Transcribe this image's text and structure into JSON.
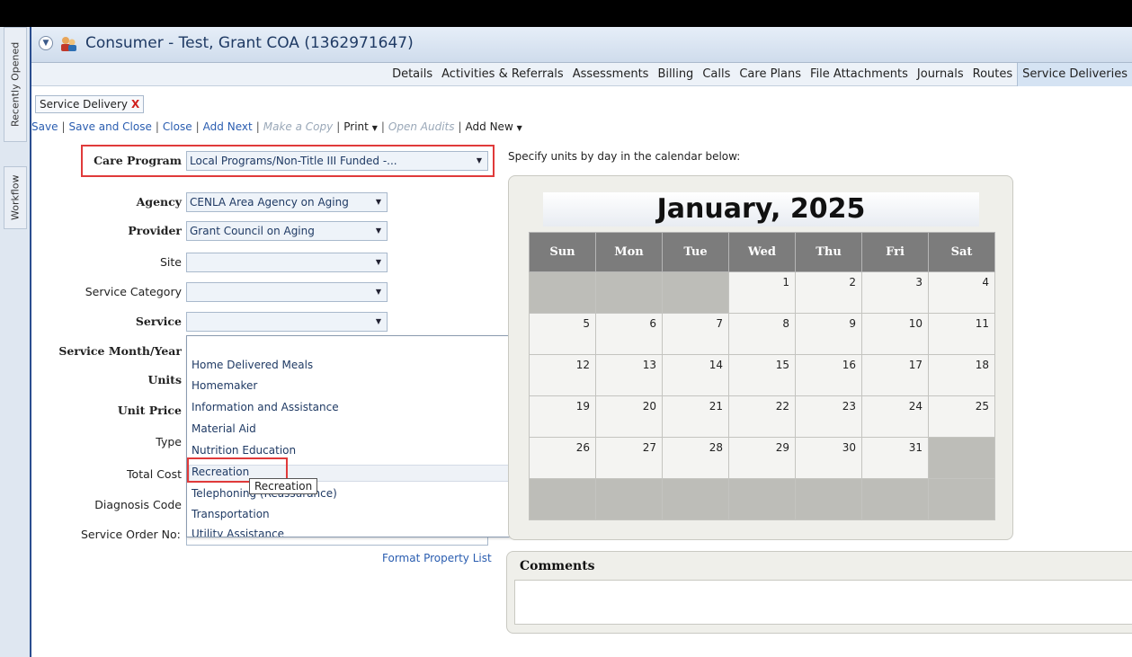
{
  "side_tabs": [
    "Recently Opened",
    "Workflow"
  ],
  "window": {
    "title": "Consumer - Test, Grant COA (1362971647)"
  },
  "tabs": [
    {
      "label": "Details"
    },
    {
      "label": "Activities & Referrals"
    },
    {
      "label": "Assessments"
    },
    {
      "label": "Billing"
    },
    {
      "label": "Calls"
    },
    {
      "label": "Care Plans"
    },
    {
      "label": "File Attachments"
    },
    {
      "label": "Journals"
    },
    {
      "label": "Routes"
    },
    {
      "label": "Service Deliveries",
      "active": true
    }
  ],
  "doc_tab": {
    "label": "Service Delivery",
    "close": "X"
  },
  "toolbar": {
    "save": "Save",
    "save_close": "Save and Close",
    "close": "Close",
    "add_next": "Add Next",
    "make_copy": "Make a Copy",
    "print": "Print",
    "open_audits": "Open Audits",
    "add_new": "Add New"
  },
  "form": {
    "care_program_label": "Care Program",
    "care_program_value": "Local Programs/Non-Title III Funded -...",
    "agency_label": "Agency",
    "agency_value": "CENLA Area Agency on Aging",
    "provider_label": "Provider",
    "provider_value": "Grant Council on Aging",
    "site_label": "Site",
    "service_category_label": "Service Category",
    "service_label": "Service",
    "service_month_year_label": "Service Month/Year",
    "units_label": "Units",
    "unit_price_label": "Unit Price",
    "type_label": "Type",
    "total_cost_label": "Total Cost",
    "diagnosis_code_label": "Diagnosis Code",
    "service_order_label": "Service Order No:",
    "format_property_list": "Format Property List"
  },
  "service_dropdown": {
    "items": [
      "Home Delivered Meals",
      "Homemaker",
      "Information and Assistance",
      "Material Aid",
      "Nutrition Education",
      "Recreation",
      "Telephoning (Reassurance)",
      "Transportation",
      "Utility Assistance"
    ],
    "hovered": "Recreation",
    "tooltip": "Recreation"
  },
  "calendar": {
    "instructions": "Specify units by day in the calendar below:",
    "title": "January, 2025",
    "days": [
      "Sun",
      "Mon",
      "Tue",
      "Wed",
      "Thu",
      "Fri",
      "Sat"
    ],
    "weeks": [
      [
        "",
        "",
        "",
        "1",
        "2",
        "3",
        "4"
      ],
      [
        "5",
        "6",
        "7",
        "8",
        "9",
        "10",
        "11"
      ],
      [
        "12",
        "13",
        "14",
        "15",
        "16",
        "17",
        "18"
      ],
      [
        "19",
        "20",
        "21",
        "22",
        "23",
        "24",
        "25"
      ],
      [
        "26",
        "27",
        "28",
        "29",
        "30",
        "31",
        ""
      ],
      [
        "",
        "",
        "",
        "",
        "",
        "",
        ""
      ]
    ]
  },
  "comments": {
    "title": "Comments"
  },
  "colors": {
    "accent": "#2a5db0",
    "highlight": "#e03a3a",
    "calendar_header": "#7c7c7c"
  }
}
